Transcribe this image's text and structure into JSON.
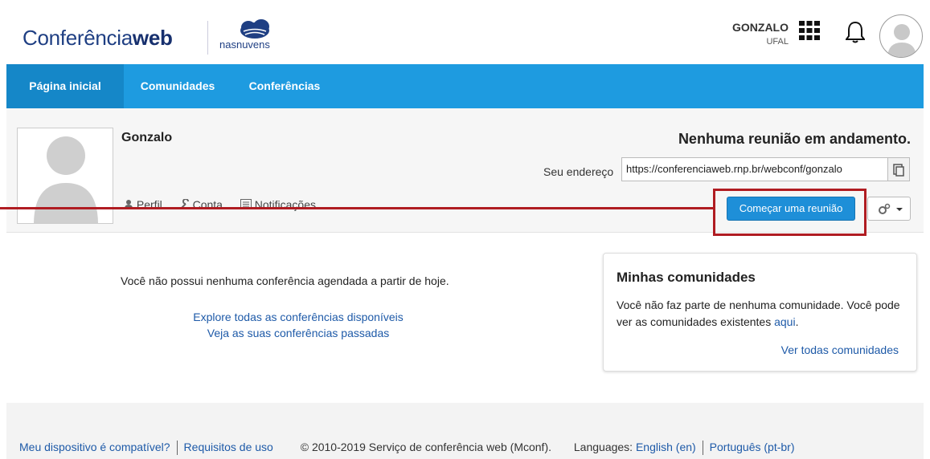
{
  "header": {
    "logo_prefix": "Conferência",
    "logo_bold": "web",
    "partner_logo": "nasnuvens",
    "user_name": "GONZALO",
    "user_org": "UFAL",
    "icons": [
      "apps-grid-icon",
      "bell-icon",
      "user-avatar-icon"
    ]
  },
  "nav": {
    "items": [
      {
        "label": "Página inicial"
      },
      {
        "label": "Comunidades"
      },
      {
        "label": "Conferências"
      }
    ]
  },
  "profile": {
    "name": "Gonzalo",
    "links": [
      {
        "label": "Perfil",
        "icon": "person-icon"
      },
      {
        "label": "Conta",
        "icon": "wrench-icon"
      },
      {
        "label": "Notificações",
        "icon": "list-icon"
      }
    ],
    "status": "Nenhuma reunião em andamento.",
    "address_label": "Seu endereço",
    "address_value": "https://conferenciaweb.rnp.br/webconf/gonzalo",
    "start_button": "Começar uma reunião"
  },
  "main": {
    "no_conferences": "Você não possui nenhuma conferência agendada a partir de hoje.",
    "explore_link": "Explore todas as conferências disponíveis",
    "past_link": "Veja as suas conferências passadas"
  },
  "communities": {
    "title": "Minhas comunidades",
    "body": "Você não faz parte de nenhuma comunidade. Você pode ver as comunidades existentes",
    "here_link": "aqui",
    "view_all": "Ver todas comunidades"
  },
  "footer": {
    "compat": "Meu dispositivo é compatível?",
    "requirements": "Requisitos de uso",
    "copyright": "© 2010-2019 Serviço de conferência web (Mconf).",
    "languages_label": "Languages:",
    "lang_en": "English (en)",
    "lang_pt": "Português (pt-br)"
  },
  "colors": {
    "nav_blue": "#1e9be0",
    "button_blue": "#1e8fd8",
    "annotation_red": "#b01c22",
    "link_blue": "#1e5aa8"
  }
}
